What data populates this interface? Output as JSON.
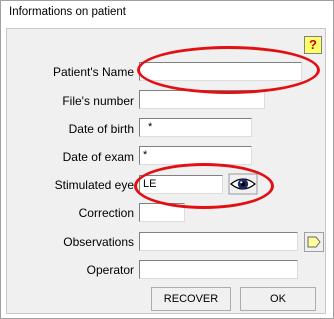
{
  "window": {
    "title": "Informations on patient"
  },
  "help": {
    "label": "?"
  },
  "form": {
    "patient_name": {
      "label": "Patient's Name",
      "value": ""
    },
    "file_number": {
      "label": "File's number",
      "value": ""
    },
    "date_of_birth": {
      "label": "Date of birth",
      "value": "*"
    },
    "date_of_exam": {
      "label": "Date of exam",
      "value": "*"
    },
    "stimulated_eye": {
      "label": "Stimulated eye",
      "value": "LE",
      "icon": "eye-icon"
    },
    "correction": {
      "label": "Correction",
      "value": ""
    },
    "observations": {
      "label": "Observations",
      "value": "",
      "icon": "note-icon"
    },
    "operator": {
      "label": "Operator",
      "value": ""
    }
  },
  "buttons": {
    "recover": "RECOVER",
    "ok": "OK"
  },
  "colors": {
    "annotation": "#e20f13",
    "help_bg": "#ffff66",
    "help_fg": "#cc0000"
  }
}
